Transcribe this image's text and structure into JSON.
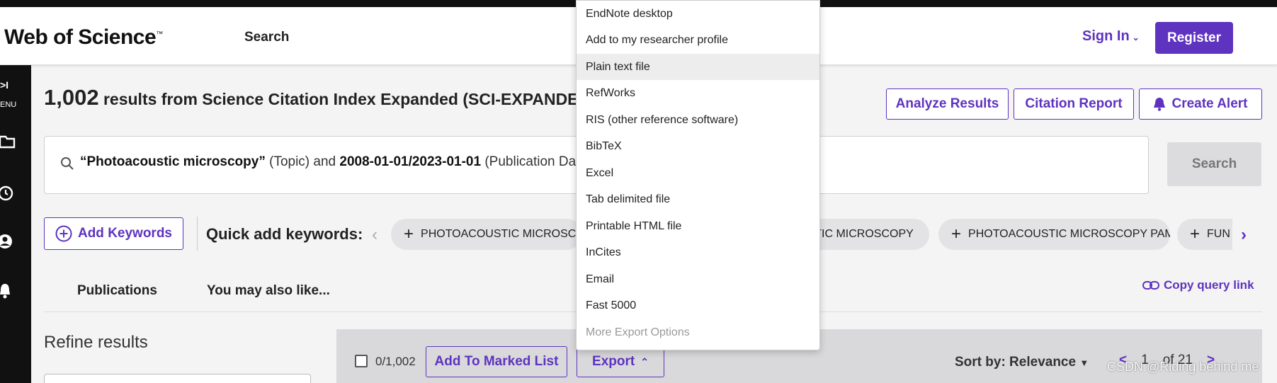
{
  "header": {
    "logo_text": "Web of Science",
    "logo_tm": "™",
    "nav_search": "Search",
    "sign_in": "Sign In",
    "register": "Register"
  },
  "sidebar": {
    "menu_arrow": ">I",
    "menu_label": "ENU"
  },
  "results": {
    "count": "1,002",
    "heading_text": " results from Science Citation Index Expanded (SCI-EXPANDED",
    "analyze": "Analyze Results",
    "citation_report": "Citation Report",
    "create_alert": "Create Alert"
  },
  "query": {
    "term1": "“Photoacoustic microscopy”",
    "field1": " (Topic) and ",
    "term2": "2008-01-01/2023-01-01",
    "field2": " (Publication Date",
    "search_button": "Search"
  },
  "keywords": {
    "add_keywords": "Add Keywords",
    "quick_add_label": "Quick add keywords:",
    "chips": [
      "PHOTOACOUSTIC MICROSCOPY",
      "USTIC MICROSCOPY",
      "PHOTOACOUSTIC MICROSCOPY PAM",
      "FUN"
    ]
  },
  "tabs": {
    "publications": "Publications",
    "also_like": "You may also like...",
    "copy_query_link": "Copy query link"
  },
  "refine": {
    "title": "Refine results"
  },
  "toolbar": {
    "selected_count": "0/1,002",
    "add_to_marked_list": "Add To Marked List",
    "export": "Export",
    "sort_by": "Sort by: Relevance",
    "page_current": "1",
    "page_of": "of",
    "page_total": "21"
  },
  "export_menu": {
    "items": [
      "EndNote desktop",
      "Add to my researcher profile",
      "Plain text file",
      "RefWorks",
      "RIS (other reference software)",
      "BibTeX",
      "Excel",
      "Tab delimited file",
      "Printable HTML file",
      "InCites",
      "Email",
      "Fast 5000",
      "More Export Options"
    ]
  },
  "watermark": "CSDN @Riding behind me",
  "colors": {
    "accent": "#5e33bf",
    "sidebar_bg": "#111111",
    "search_disabled_bg": "#dcdcdf"
  }
}
